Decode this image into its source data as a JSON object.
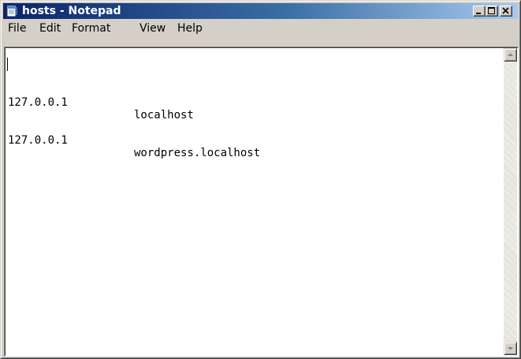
{
  "window": {
    "title": "hosts - Notepad",
    "icon": "notepad-icon",
    "controls": [
      "minimize-icon",
      "maximize-icon",
      "close-icon"
    ]
  },
  "menu": [
    "File",
    "Edit",
    "Format",
    "View",
    "Help"
  ],
  "document": {
    "lines": [
      {
        "ip": "127.0.0.1",
        "host": "localhost"
      },
      {
        "ip": "127.0.0.1",
        "host": "wordpress.localhost"
      }
    ]
  },
  "scrollbar": {
    "up_icon": "arrow-up-icon",
    "down_icon": "arrow-down-icon"
  }
}
